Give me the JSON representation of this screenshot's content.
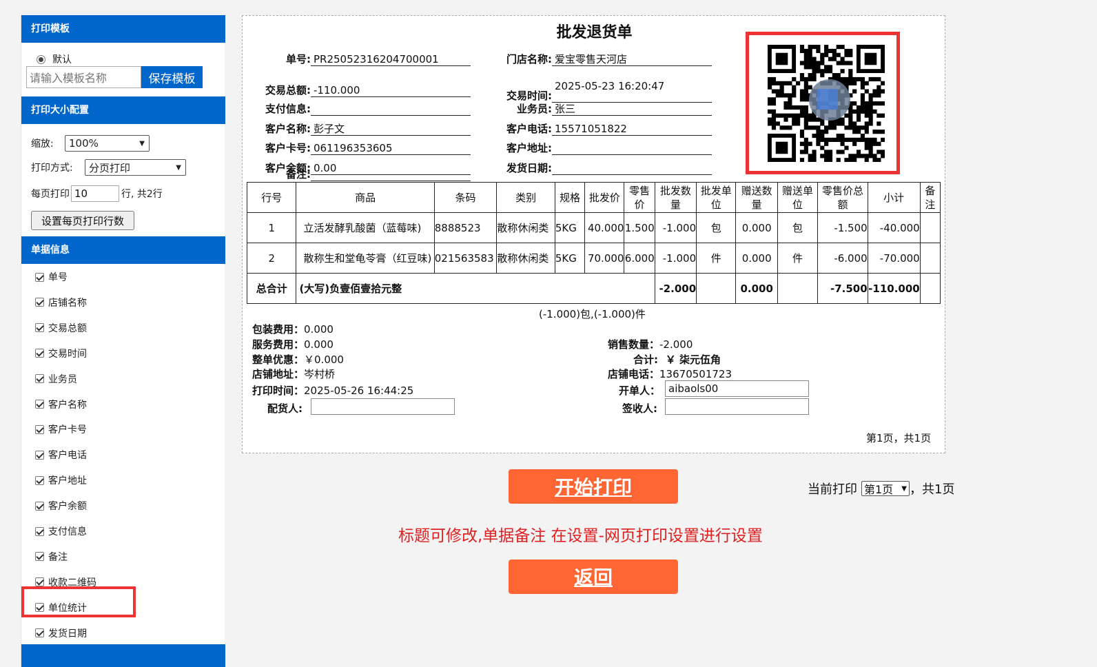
{
  "sidebar": {
    "sec_template": "打印模板",
    "radio_default": "默认",
    "template_placeholder": "请输入模板名称",
    "save_template": "保存模板",
    "sec_size": "打印大小配置",
    "zoom_label": "缩放:",
    "zoom_value": "100%",
    "mode_label": "打印方式:",
    "mode_value": "分页打印",
    "per_page_label": "每页打印",
    "per_page_value": "10",
    "per_page_suffix": "行,  共2行",
    "set_rows_button": "设置每页打印行数",
    "sec_info": "单据信息",
    "options": [
      "单号",
      "店铺名称",
      "交易总额",
      "交易时间",
      "业务员",
      "客户名称",
      "客户卡号",
      "客户电话",
      "客户地址",
      "客户余额",
      "支付信息",
      "备注",
      "收款二维码",
      "单位统计",
      "发货日期"
    ]
  },
  "doc": {
    "title": "批发退货单",
    "fields_left": [
      {
        "label": "单号:",
        "value": "PR25052316204700001"
      },
      {
        "label": "交易总额:",
        "value": "-110.000"
      },
      {
        "label": "支付信息:",
        "value": ""
      },
      {
        "label": "客户名称:",
        "value": "彭子文"
      },
      {
        "label": "客户卡号:",
        "value": "061196353605"
      },
      {
        "label": "客户余额:",
        "value": "0.00"
      },
      {
        "label": "备注:",
        "value": ""
      }
    ],
    "fields_right": [
      {
        "label": "门店名称:",
        "value": "爱宝零售天河店"
      },
      {
        "label": "交易时间:",
        "value": "2025-05-23 16:20:47"
      },
      {
        "label": "业务员:",
        "value": "张三"
      },
      {
        "label": "客户电话:",
        "value": "15571051822"
      },
      {
        "label": "客户地址:",
        "value": ""
      },
      {
        "label": "发货日期:",
        "value": ""
      }
    ],
    "headers": [
      "行号",
      "商品",
      "条码",
      "类别",
      "规格",
      "批发价",
      "零售价",
      "批发数量",
      "批发单位",
      "赠送数量",
      "赠送单位",
      "零售价总额",
      "小计",
      "备注"
    ],
    "rows": [
      [
        "1",
        "立活发酵乳酸菌（蓝莓味)",
        "8888523",
        "散称休闲类",
        "5KG",
        "40.000",
        "1.500",
        "-1.000",
        "包",
        "0.000",
        "包",
        "-1.500",
        "-40.000",
        ""
      ],
      [
        "2",
        "散称生和堂龟苓膏（红豆味)",
        "021563583",
        "散称休闲类",
        "5KG",
        "70.000",
        "6.000",
        "-1.000",
        "件",
        "0.000",
        "件",
        "-6.000",
        "-70.000",
        ""
      ]
    ],
    "total": {
      "label": "总合计",
      "words": "(大写)负壹佰壹拾元整",
      "qty": "-2.000",
      "gift": "0.000",
      "retail": "-7.500",
      "subtotal": "-110.000"
    },
    "unit_summary": "(-1.000)包,(-1.000)件",
    "pack_fee_label": "包装费用：",
    "pack_fee": "0.000",
    "service_fee_label": "服务费用：",
    "service_fee": "0.000",
    "discount_label": "整单优惠：",
    "discount": "￥0.000",
    "shop_addr_label": "店铺地址：",
    "shop_addr": "岑村桥",
    "print_time_label": "打印时间：",
    "print_time": "2025-05-26 16:44:25",
    "picker_label": "配货人:",
    "sales_qty_label": "销售数量：",
    "sales_qty": "-2.000",
    "sum_label": "合计:",
    "sum": "￥ 柒元伍角",
    "shop_tel_label": "店铺电话：",
    "shop_tel": "13670501723",
    "issuer_label": "开单人：",
    "issuer": "aibaols00",
    "receiver_label": "签收人:",
    "page_info": "第1页，共1页"
  },
  "actions": {
    "print_button": "开始打印",
    "current_label": "当前打印",
    "page_select": "第1页",
    "total_pages": "，共1页",
    "notice": "标题可修改,单据备注 在设置-网页打印设置进行设置",
    "back_button": "返回"
  },
  "colors": {
    "accent": "#0066cc",
    "orange": "#ff6633",
    "highlight": "#ee3333",
    "notice": "#e02020"
  }
}
